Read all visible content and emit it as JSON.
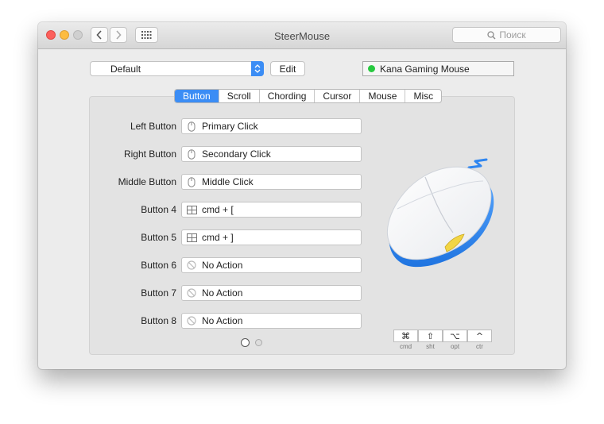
{
  "window": {
    "title": "SteerMouse"
  },
  "search": {
    "placeholder": "Поиск"
  },
  "preset": {
    "selected": "Default",
    "edit_label": "Edit"
  },
  "device": {
    "name": "Kana Gaming Mouse",
    "status_color": "#27c93f"
  },
  "tabs": [
    {
      "label": "Button",
      "active": true
    },
    {
      "label": "Scroll",
      "active": false
    },
    {
      "label": "Chording",
      "active": false
    },
    {
      "label": "Cursor",
      "active": false
    },
    {
      "label": "Mouse",
      "active": false
    },
    {
      "label": "Misc",
      "active": false
    }
  ],
  "buttons": [
    {
      "label": "Left Button",
      "action": "Primary Click",
      "icon": "mouse-icon"
    },
    {
      "label": "Right Button",
      "action": "Secondary Click",
      "icon": "mouse-icon"
    },
    {
      "label": "Middle Button",
      "action": "Middle Click",
      "icon": "mouse-icon"
    },
    {
      "label": "Button 4",
      "action": "cmd + [",
      "icon": "keyboard-icon"
    },
    {
      "label": "Button 5",
      "action": "cmd + ]",
      "icon": "keyboard-icon"
    },
    {
      "label": "Button 6",
      "action": "No Action",
      "icon": "no-action-icon"
    },
    {
      "label": "Button 7",
      "action": "No Action",
      "icon": "no-action-icon"
    },
    {
      "label": "Button 8",
      "action": "No Action",
      "icon": "no-action-icon"
    }
  ],
  "pager": {
    "pages": 2,
    "current": 1
  },
  "modifiers": [
    {
      "symbol": "⌘",
      "label": "cmd"
    },
    {
      "symbol": "⇧",
      "label": "sht"
    },
    {
      "symbol": "⌥",
      "label": "opt"
    },
    {
      "symbol": "^",
      "label": "ctr"
    }
  ],
  "colors": {
    "accent": "#3b8df5",
    "mouse_base": "#3b8df5",
    "mouse_highlight": "#f2d545"
  }
}
